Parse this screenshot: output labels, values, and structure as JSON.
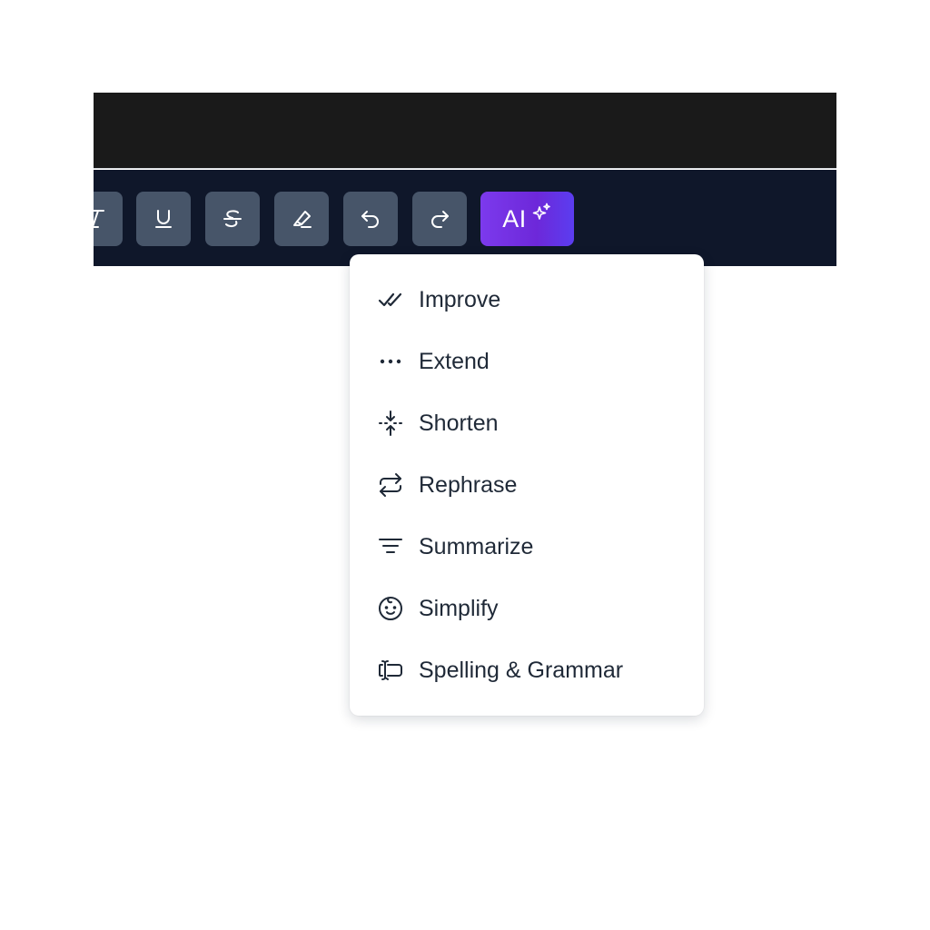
{
  "toolbar": {
    "buttons": [
      {
        "name": "italic",
        "icon": "italic-icon"
      },
      {
        "name": "underline",
        "icon": "underline-icon"
      },
      {
        "name": "strikethrough",
        "icon": "strikethrough-icon"
      },
      {
        "name": "highlight",
        "icon": "highlighter-icon"
      },
      {
        "name": "undo",
        "icon": "undo-icon"
      },
      {
        "name": "redo",
        "icon": "redo-icon"
      }
    ],
    "ai_button": {
      "label": "AI",
      "icon": "sparkles-icon"
    }
  },
  "ai_menu": {
    "items": [
      {
        "label": "Improve",
        "icon": "double-check-icon"
      },
      {
        "label": "Extend",
        "icon": "dots-horizontal-icon"
      },
      {
        "label": "Shorten",
        "icon": "compress-arrows-icon"
      },
      {
        "label": "Rephrase",
        "icon": "repeat-icon"
      },
      {
        "label": "Summarize",
        "icon": "filter-lines-icon"
      },
      {
        "label": "Simplify",
        "icon": "baby-face-icon"
      },
      {
        "label": "Spelling & Grammar",
        "icon": "text-cursor-icon"
      }
    ]
  },
  "colors": {
    "topbar": "#1a1a1a",
    "toolbar": "#0f172a",
    "tool_button": "#475569",
    "ai_gradient_start": "#7c3aed",
    "ai_gradient_end": "#5b3df0",
    "menu_text": "#1f2937"
  }
}
